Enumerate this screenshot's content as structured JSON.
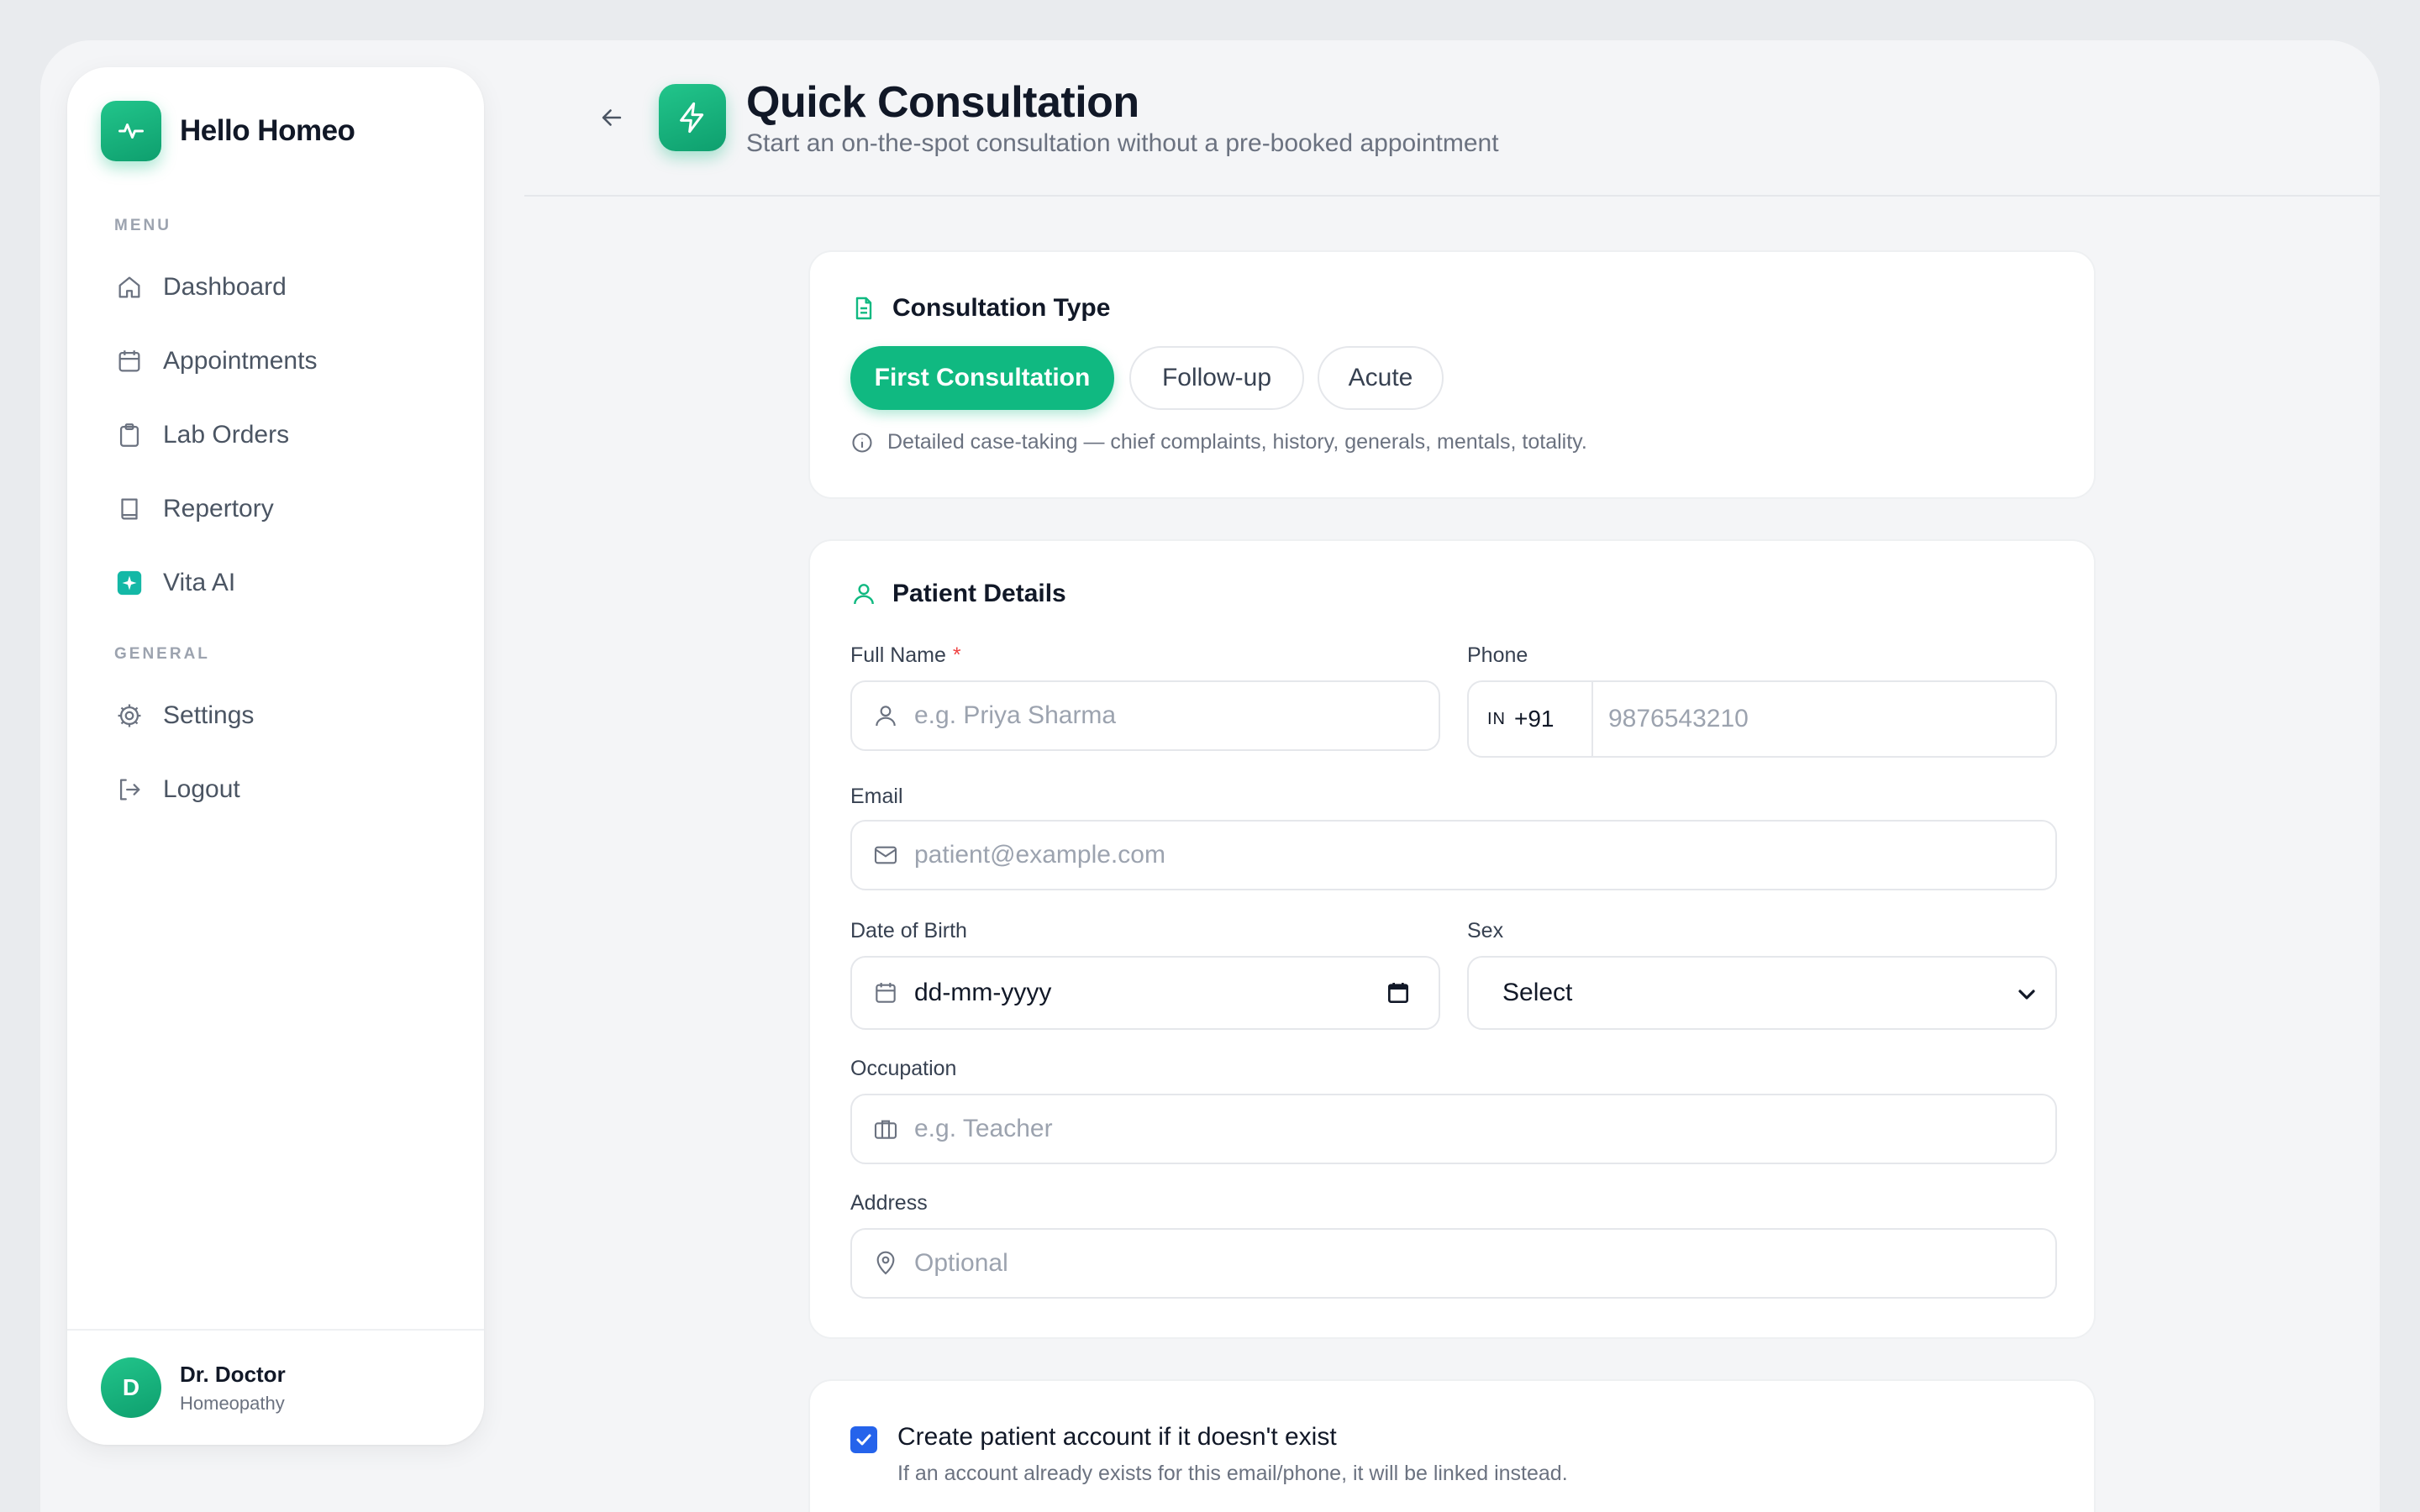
{
  "brand": {
    "name": "Hello Homeo"
  },
  "sidebar": {
    "menu_label": "MENU",
    "menu_items": [
      {
        "label": "Dashboard",
        "icon": "home-icon"
      },
      {
        "label": "Appointments",
        "icon": "calendar-icon"
      },
      {
        "label": "Lab Orders",
        "icon": "clipboard-icon"
      },
      {
        "label": "Repertory",
        "icon": "book-icon"
      },
      {
        "label": "Vita AI",
        "icon": "sparkle-icon"
      }
    ],
    "general_label": "GENERAL",
    "general_items": [
      {
        "label": "Settings",
        "icon": "gear-icon"
      },
      {
        "label": "Logout",
        "icon": "logout-icon"
      }
    ],
    "user": {
      "initial": "D",
      "name": "Dr. Doctor",
      "role": "Homeopathy"
    }
  },
  "header": {
    "title": "Quick Consultation",
    "subtitle": "Start an on-the-spot consultation without a pre-booked appointment"
  },
  "consultation_type": {
    "title": "Consultation Type",
    "options": [
      "First Consultation",
      "Follow-up",
      "Acute"
    ],
    "selected": "First Consultation",
    "hint": "Detailed case-taking — chief complaints, history, generals, mentals, totality."
  },
  "patient_details": {
    "title": "Patient Details",
    "full_name": {
      "label": "Full Name",
      "required_mark": "*",
      "placeholder": "e.g. Priya Sharma"
    },
    "phone": {
      "label": "Phone",
      "country_code": "IN",
      "dial_code": "+91",
      "placeholder": "9876543210"
    },
    "email": {
      "label": "Email",
      "placeholder": "patient@example.com"
    },
    "dob": {
      "label": "Date of Birth",
      "placeholder": "dd-mm-yyyy"
    },
    "sex": {
      "label": "Sex",
      "value": "Select"
    },
    "occupation": {
      "label": "Occupation",
      "placeholder": "e.g. Teacher"
    },
    "address": {
      "label": "Address",
      "placeholder": "Optional"
    }
  },
  "account": {
    "checked": true,
    "title": "Create patient account if it doesn't exist",
    "subtitle": "If an account already exists for this email/phone, it will be linked instead."
  },
  "colors": {
    "accent": "#10b981",
    "checkbox": "#2563eb",
    "required": "#ef4444"
  }
}
